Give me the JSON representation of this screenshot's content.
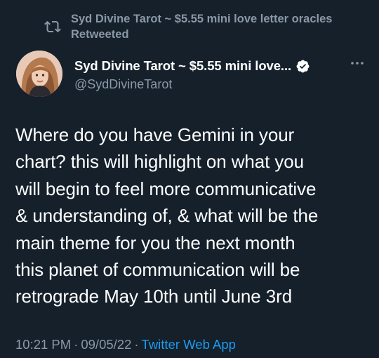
{
  "retweet": {
    "icon": "retweet-icon",
    "text": "Syd Divine Tarot ~ $5.55 mini love letter oracles Retweeted"
  },
  "author": {
    "display_name": "Syd Divine Tarot ~ $5.55 mini love...",
    "handle": "@SydDivineTarot",
    "verified_icon": "verified-badge-icon",
    "more_icon": "more-options-icon"
  },
  "tweet": {
    "text": "Where do you have Gemini in your\nchart? this will highlight on what you\nwill begin to feel more communicative\n& understanding of, & what will be the\nmain theme for you the next month\nthis planet of communication will be\nretrograde May 10th until June 3rd"
  },
  "meta": {
    "time": "10:21 PM",
    "separator": "·",
    "date": "09/05/22",
    "source": "Twitter Web App"
  },
  "colors": {
    "background": "#15202b",
    "secondary_text": "#8b98a5",
    "accent": "#1d9bf0"
  }
}
